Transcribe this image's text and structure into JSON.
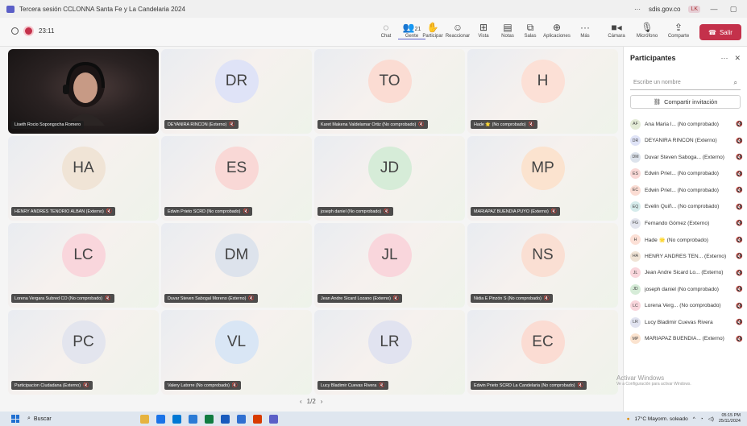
{
  "window": {
    "title": "Tercera sesión CCLONNA Santa Fe y La Candelaria 2024",
    "account": "sdis.gov.co",
    "account_badge": "LK"
  },
  "meeting": {
    "timer": "23:11"
  },
  "toolbar": {
    "chat": "Chat",
    "people": "Gente",
    "people_count": "21",
    "raise": "Participar",
    "react": "Reaccionar",
    "view": "Vista",
    "notes": "Notas",
    "rooms": "Salas",
    "apps": "Aplicaciones",
    "more": "Más",
    "camera": "Cámara",
    "mic": "Micrófono",
    "share": "Comparte",
    "leave": "Salir"
  },
  "tiles": [
    {
      "type": "video",
      "name": "Liseth Rocio Sopongocha Romero"
    },
    {
      "initials": "DR",
      "name": "DEYANIRA RINCON (Externo)",
      "color": "#dfe3f7"
    },
    {
      "initials": "TO",
      "name": "Karet Makena Valdelamar Ortiz (No comprobado)",
      "color": "#fbdcd3"
    },
    {
      "initials": "H",
      "name": "Hade 🌟 (No comprobado)",
      "color": "#fce0d6"
    },
    {
      "initials": "HA",
      "name": "HENRY ANDRES TENORIO ALBAN (Externo)",
      "color": "#f0e4d6"
    },
    {
      "initials": "ES",
      "name": "Edwin Prieto SCRD (No comprobado)",
      "color": "#f9d8d6"
    },
    {
      "initials": "JD",
      "name": "joseph daniel (No comprobado)",
      "color": "#d6ecd8"
    },
    {
      "initials": "MP",
      "name": "MARIAPAZ BUENDIA PUYO (Externo)",
      "color": "#fbe3cf"
    },
    {
      "initials": "LC",
      "name": "Lorena Vergara Subred CO (No comprobado)",
      "color": "#f9d6dc"
    },
    {
      "initials": "DM",
      "name": "Duvar Steven Sabogal Moreno (Externo)",
      "color": "#dde3ec"
    },
    {
      "initials": "JL",
      "name": "Jean Andre Sicard Lozano (Externo)",
      "color": "#f9d6dc"
    },
    {
      "initials": "NS",
      "name": "Nidia E Pinzón S (No comprobado)",
      "color": "#fadfd3"
    },
    {
      "initials": "PC",
      "name": "Participacion Ciudadana (Externo)",
      "color": "#e3e5ee"
    },
    {
      "initials": "VL",
      "name": "Valery Latorre (No comprobado)",
      "color": "#d9e6f5"
    },
    {
      "initials": "LR",
      "name": "Lucy Bladimir Cuevas Rivera",
      "color": "#e1e3f0"
    },
    {
      "initials": "EC",
      "name": "Edwin Prieto SCRD La Candelaria (No comprobado)",
      "color": "#fbdcd3"
    }
  ],
  "pager": {
    "prev": "‹",
    "label": "1/2",
    "next": "›"
  },
  "panel": {
    "title": "Participantes",
    "more": "···",
    "close": "✕",
    "search_placeholder": "Escribe un nombre",
    "invite": "Compartir invitación",
    "participants": [
      {
        "initials": "AF",
        "name": "Ana Maria l... (No comprobado)",
        "color": "#e4ecd7"
      },
      {
        "initials": "DR",
        "name": "DEYANIRA RINCON (Externo)",
        "color": "#dfe3f7"
      },
      {
        "initials": "DM",
        "name": "Duvar Steven Saboga... (Externo)",
        "color": "#dde3ec"
      },
      {
        "initials": "ES",
        "name": "Edwin Priet... (No comprobado)",
        "color": "#f9d8d6"
      },
      {
        "initials": "EC",
        "name": "Edwin Priet... (No comprobado)",
        "color": "#fbdcd3"
      },
      {
        "initials": "EQ",
        "name": "Evelin Quiñ... (No comprobado)",
        "color": "#d6ecec"
      },
      {
        "initials": "FG",
        "name": "Fernando Gómez (Externo)",
        "color": "#e3e5ee"
      },
      {
        "initials": "H",
        "name": "Hade 🌟 (No comprobado)",
        "color": "#fce0d6"
      },
      {
        "initials": "HA",
        "name": "HENRY ANDRES TEN... (Externo)",
        "color": "#f0e4d6"
      },
      {
        "initials": "JL",
        "name": "Jean Andre Sicard Lo... (Externo)",
        "color": "#f9d6dc"
      },
      {
        "initials": "JD",
        "name": "joseph daniel (No comprobado)",
        "color": "#d6ecd8"
      },
      {
        "initials": "LC",
        "name": "Lorena Verg... (No comprobado)",
        "color": "#f9d6dc"
      },
      {
        "initials": "LR",
        "name": "Lucy Bladimir Cuevas Rivera",
        "color": "#e1e3f0"
      },
      {
        "initials": "MP",
        "name": "MARIAPAZ BUENDIA... (Externo)",
        "color": "#fbe3cf"
      }
    ]
  },
  "watermark": {
    "title": "Activar Windows",
    "sub": "Ve a Configuración para activar Windows."
  },
  "taskbar": {
    "search": "Buscar",
    "weather": "17°C  Mayorm. soleado",
    "time": "05:15 PM",
    "date": "25/11/2024"
  }
}
